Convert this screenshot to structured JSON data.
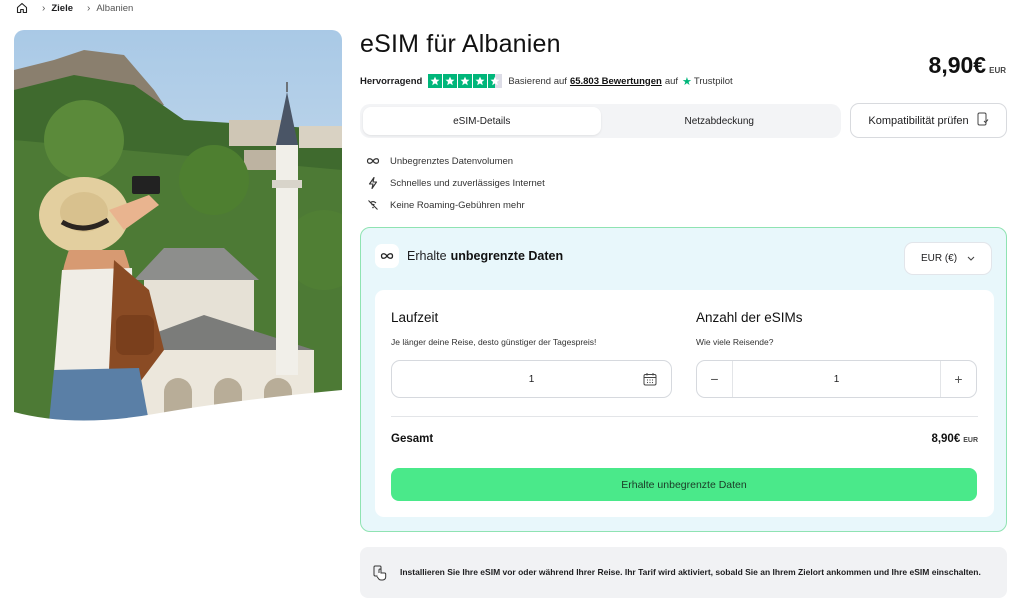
{
  "breadcrumb": {
    "home_icon": "home-icon",
    "items": [
      "Ziele",
      "Albanien"
    ]
  },
  "product": {
    "title": "eSIM für Albanien",
    "price": "8,90€",
    "currency_code": "EUR"
  },
  "rating": {
    "grade": "Hervorragend",
    "stars": 4.5,
    "based_on": "Basierend auf",
    "count": "65.803 Bewertungen",
    "on": "auf",
    "provider": "Trustpilot",
    "star_color": "#00b67a"
  },
  "tabs": [
    {
      "label": "eSIM-Details",
      "active": true
    },
    {
      "label": "Netzabdeckung",
      "active": false
    }
  ],
  "compat_button": {
    "label": "Kompatibilität prüfen",
    "icon": "phone-check-icon"
  },
  "features": [
    {
      "icon": "infinity-icon",
      "text": "Unbegrenztes Datenvolumen"
    },
    {
      "icon": "lightning-icon",
      "text": "Schnelles und zuverlässiges Internet"
    },
    {
      "icon": "no-roaming-icon",
      "text": "Keine Roaming-Gebühren mehr"
    }
  ],
  "plan": {
    "heading_prefix": "Erhalte",
    "heading_bold": "unbegrenzte Daten",
    "currency_select": "EUR (€)",
    "duration": {
      "title": "Laufzeit",
      "subtitle": "Je länger deine Reise, desto günstiger der Tagespreis!",
      "value": "1"
    },
    "esims": {
      "title": "Anzahl der eSIMs",
      "subtitle": "Wie viele Reisende?",
      "value": "1",
      "minus": "−",
      "plus": "+"
    },
    "total_label": "Gesamt",
    "total_price": "8,90€",
    "total_currency": "EUR",
    "cta_label": "Erhalte unbegrenzte Daten",
    "cta_color": "#4ae98a",
    "box_border_color": "#8fe3b2",
    "box_bg_color": "#e8f7fb"
  },
  "install_note": {
    "icon": "hand-tap-icon",
    "text": "Installieren Sie Ihre eSIM vor oder während Ihrer Reise. Ihr Tarif wird aktiviert, sobald Sie an Ihrem Zielort ankommen und Ihre eSIM einschalten."
  }
}
